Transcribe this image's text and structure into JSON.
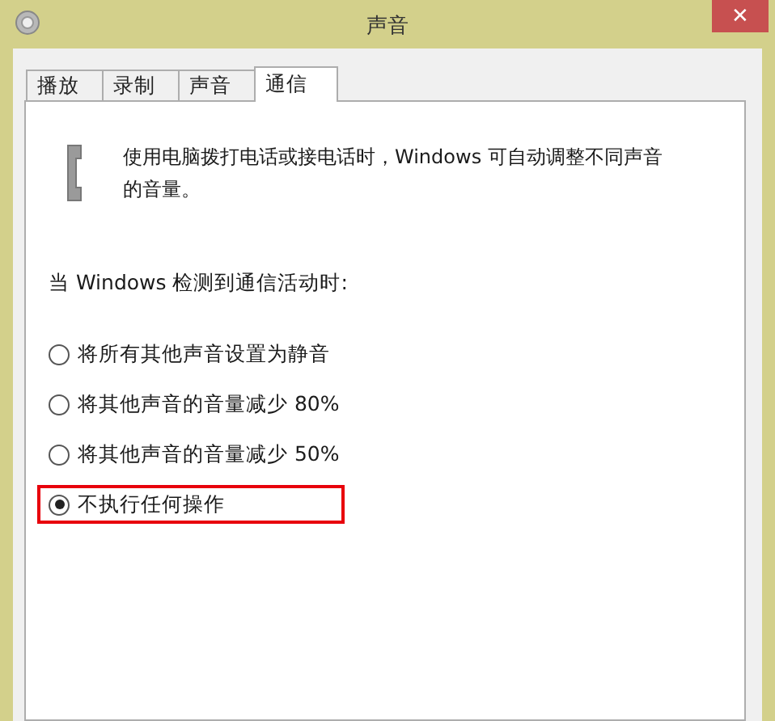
{
  "window": {
    "title": "声音",
    "close": "✕"
  },
  "tabs": [
    {
      "label": "播放",
      "selected": false
    },
    {
      "label": "录制",
      "selected": false
    },
    {
      "label": "声音",
      "selected": false
    },
    {
      "label": "通信",
      "selected": true
    }
  ],
  "description": "使用电脑拨打电话或接电话时，Windows 可自动调整不同声音的音量。",
  "prompt": "当 Windows 检测到通信活动时:",
  "options": [
    {
      "label": "将所有其他声音设置为静音",
      "selected": false,
      "highlighted": false
    },
    {
      "label": "将其他声音的音量减少 80%",
      "selected": false,
      "highlighted": false
    },
    {
      "label": "将其他声音的音量减少 50%",
      "selected": false,
      "highlighted": false
    },
    {
      "label": "不执行任何操作",
      "selected": true,
      "highlighted": true
    }
  ]
}
